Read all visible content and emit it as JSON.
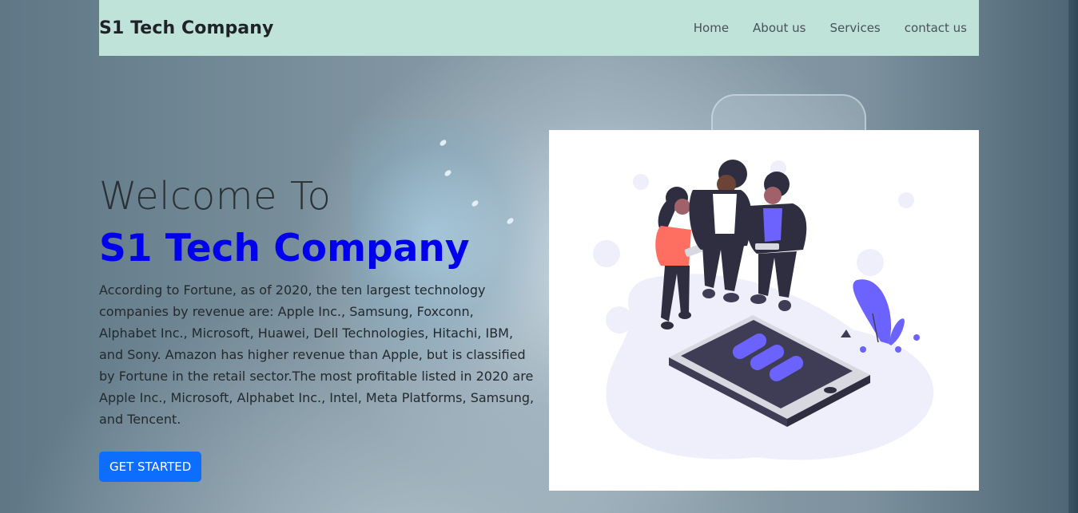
{
  "navbar": {
    "brand": "S1 Tech Company",
    "links": [
      "Home",
      "About us",
      "Services",
      "contact us"
    ]
  },
  "hero": {
    "welcome": "Welcome To",
    "company": "S1 Tech Company",
    "description": "According to Fortune, as of 2020, the ten largest technology companies by revenue are: Apple Inc., Samsung, Foxconn, Alphabet Inc., Microsoft, Huawei, Dell Technologies, Hitachi, IBM, and Sony. Amazon has higher revenue than Apple, but is classified by Fortune in the retail sector.The most profitable listed in 2020 are Apple Inc., Microsoft, Alphabet Inc., Intel, Meta Platforms, Samsung, and Tencent.",
    "cta_label": "GET STARTED"
  },
  "colors": {
    "navbar_bg": "#bfe2d9",
    "accent_blue": "#0000ee",
    "button_blue": "#0d6efd",
    "illustration_purple": "#6c63ff"
  }
}
